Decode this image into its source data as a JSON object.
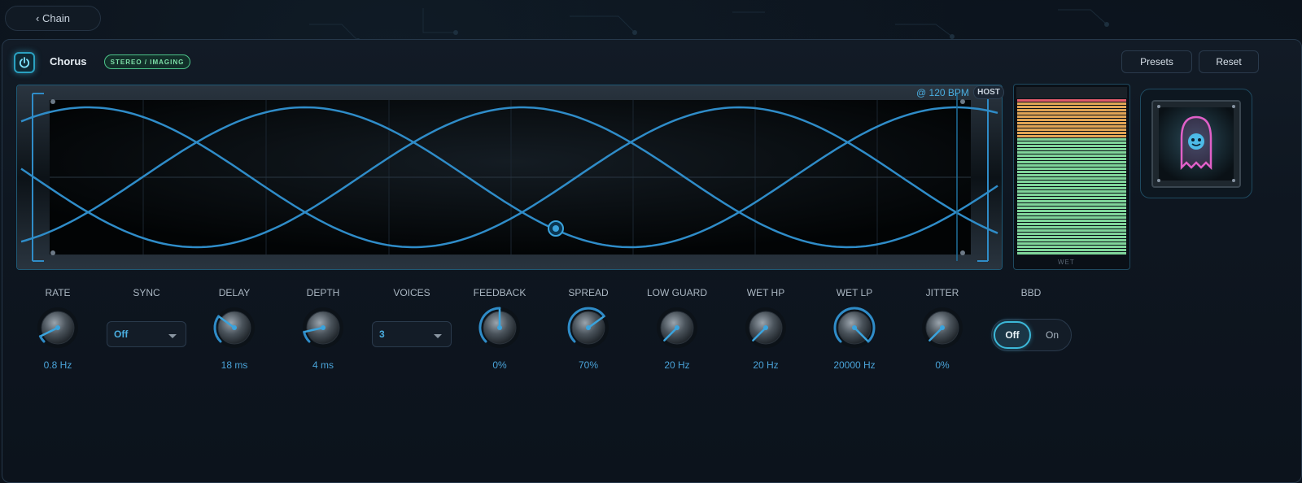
{
  "nav": {
    "back_label": "‹ Chain"
  },
  "plugin": {
    "title": "Chorus",
    "badge": "STEREO / IMAGING",
    "presets_label": "Presets",
    "reset_label": "Reset",
    "accent_color": "#3cb8d8"
  },
  "scope": {
    "tempo_label": "@ 120 BPM",
    "host_label": "HOST",
    "waveform": "sine",
    "voices_drawn": 3
  },
  "meter": {
    "label": "WET",
    "colors": {
      "low": "#7fd49a",
      "mid": "#e0a455",
      "high": "#e05a6a"
    }
  },
  "art": {
    "icon": "ghost-icon"
  },
  "controls": [
    {
      "id": "rate",
      "label": "RATE",
      "value": "0.8 Hz",
      "kind": "knob",
      "level": 0.07
    },
    {
      "id": "sync",
      "label": "SYNC",
      "value": "Off",
      "kind": "select"
    },
    {
      "id": "delay",
      "label": "DELAY",
      "value": "18 ms",
      "kind": "knob",
      "level": 0.3
    },
    {
      "id": "depth",
      "label": "DEPTH",
      "value": "4 ms",
      "kind": "knob",
      "level": 0.12
    },
    {
      "id": "voices",
      "label": "VOICES",
      "value": "3",
      "kind": "select"
    },
    {
      "id": "feedback",
      "label": "FEEDBACK",
      "value": "0%",
      "kind": "knob",
      "level": 0.5
    },
    {
      "id": "spread",
      "label": "SPREAD",
      "value": "70%",
      "kind": "knob",
      "level": 0.7
    },
    {
      "id": "low_guard",
      "label": "LOW GUARD",
      "value": "20 Hz",
      "kind": "knob",
      "level": 0.0
    },
    {
      "id": "wet_hp",
      "label": "WET HP",
      "value": "20 Hz",
      "kind": "knob",
      "level": 0.0
    },
    {
      "id": "wet_lp",
      "label": "WET LP",
      "value": "20000 Hz",
      "kind": "knob",
      "level": 1.0
    },
    {
      "id": "jitter",
      "label": "JITTER",
      "value": "0%",
      "kind": "knob",
      "level": 0.0
    },
    {
      "id": "bbd",
      "label": "BBD",
      "kind": "toggle",
      "options": [
        "Off",
        "On"
      ],
      "selected": "Off"
    }
  ]
}
